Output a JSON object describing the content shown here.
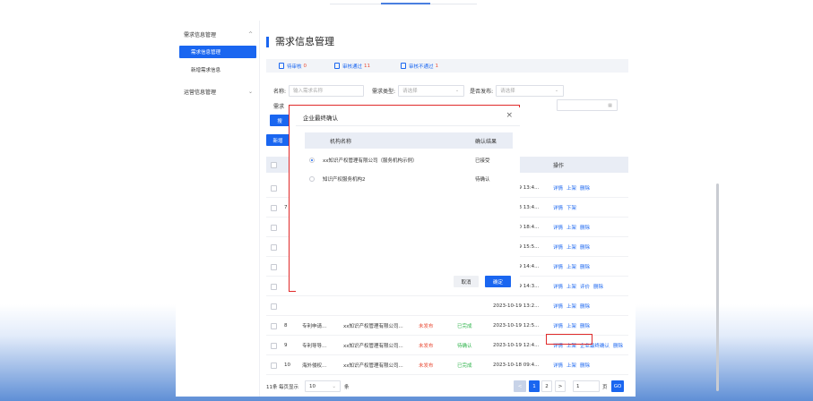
{
  "sidebar": {
    "groups": [
      {
        "label": "需求信息管理",
        "chevron": "^",
        "items": [
          {
            "label": "需求信息管理",
            "active": true
          },
          {
            "label": "新增需求信息",
            "active": false
          }
        ]
      },
      {
        "label": "运营信息管理",
        "chevron": "⌄",
        "items": []
      }
    ]
  },
  "page_title": "需求信息管理",
  "tabs": [
    {
      "label": "待审核",
      "count": "0"
    },
    {
      "label": "审核通过",
      "count": "11"
    },
    {
      "label": "审核不通过",
      "count": "1"
    }
  ],
  "filters": {
    "name_label": "名称:",
    "name_placeholder": "输入需求名称",
    "type_label": "需求类型:",
    "type_placeholder": "请选择",
    "publish_label": "是否发布:",
    "publish_placeholder": "请选择",
    "row2_label_prefix": "需求",
    "search_button_prefix": "搜"
  },
  "add_button_prefix": "新增",
  "table": {
    "operation_header": "操作",
    "rows": [
      {
        "no": "",
        "time": "2023-10-19 13:4...",
        "ops": [
          "详情",
          "上架",
          "删除"
        ]
      },
      {
        "no": "7",
        "time": "2023-10-23 13:4...",
        "ops": [
          "详情",
          "下架"
        ]
      },
      {
        "no": "",
        "time": "2023-10-20 18:4...",
        "ops": [
          "详情",
          "上架",
          "删除"
        ]
      },
      {
        "no": "",
        "time": "2023-10-19 15:5...",
        "ops": [
          "详情",
          "上架",
          "删除"
        ]
      },
      {
        "no": "",
        "time": "2023-10-19 14:4...",
        "ops": [
          "详情",
          "上架",
          "删除"
        ]
      },
      {
        "no": "",
        "time": "2023-10-19 14:3...",
        "ops": [
          "详情",
          "上架",
          "评价",
          "删除"
        ]
      },
      {
        "no": "",
        "time": "2023-10-19 13:2...",
        "ops": [
          "详情",
          "上架",
          "删除"
        ]
      },
      {
        "no": "8",
        "name": "专利申请...",
        "org": "xx知识产权管理有限公司...",
        "publish": "未发布",
        "status": "已完成",
        "time": "2023-10-19 12:5...",
        "ops": [
          "详情",
          "上架",
          "删除"
        ]
      },
      {
        "no": "9",
        "name": "专利导导...",
        "org": "xx知识产权管理有限公司...",
        "publish": "未发布",
        "status": "待确认",
        "time": "2023-10-19 12:4...",
        "ops": [
          "详情",
          "上架",
          "企业最终确认",
          "删除"
        ]
      },
      {
        "no": "10",
        "name": "海外侵权...",
        "org": "xx知识产权管理有限公司...",
        "publish": "未发布",
        "status": "已完成",
        "time": "2023-10-18 09:4...",
        "ops": [
          "详情",
          "上架",
          "删除"
        ]
      }
    ]
  },
  "pager": {
    "total": "11条",
    "per_page_label": "每页显示",
    "per_page": "10",
    "per_page_unit": "条",
    "prev": "<",
    "pages": [
      "1",
      "2"
    ],
    "next": ">",
    "jump_value": "1",
    "page_unit": "页",
    "go": "GO"
  },
  "dialog": {
    "title": "企业最终确认",
    "close": "×",
    "columns": [
      "机构名称",
      "确认结果"
    ],
    "rows": [
      {
        "name": "xx知识产权管理有限公司（服务机构示例）",
        "result": "已接受",
        "selected": true
      },
      {
        "name": "知识产权服务机构2",
        "result": "待确认",
        "selected": false
      }
    ],
    "cancel": "取消",
    "ok": "确定"
  },
  "colors": {
    "primary": "#1a66f0",
    "danger": "#e94b35",
    "success": "#2db34a",
    "annotation": "#e02a2a"
  }
}
